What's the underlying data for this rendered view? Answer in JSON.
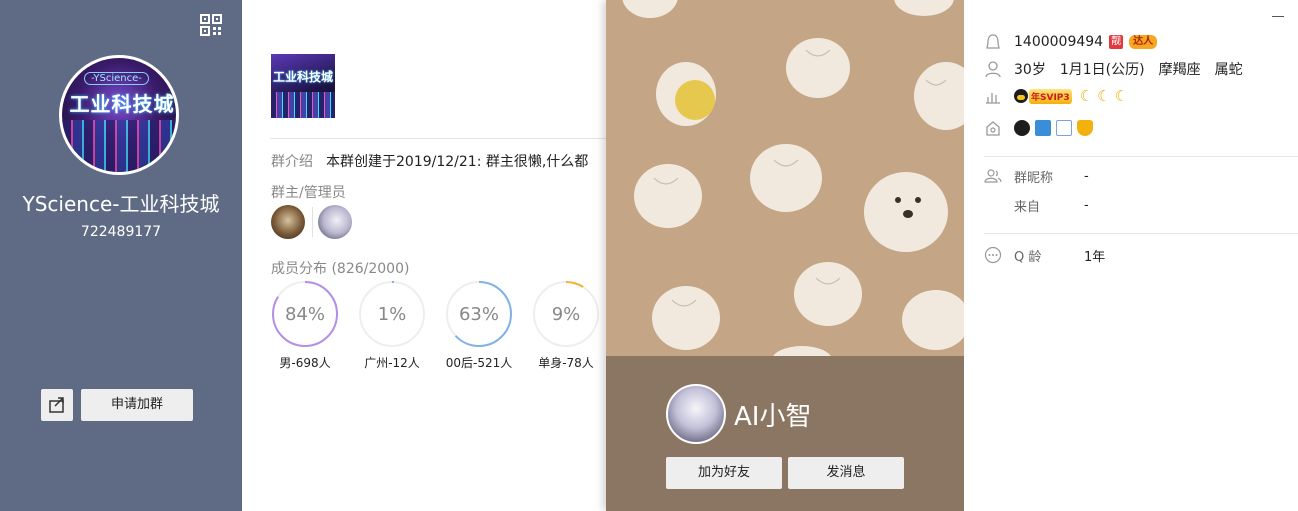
{
  "group": {
    "name": "YScience-工业科技城",
    "id": "722489177",
    "avatar_text": "工业科技城",
    "avatar_tag": "-YScience-",
    "apply_label": "申请加群"
  },
  "info": {
    "intro_label": "群介绍",
    "intro_text": "本群创建于2019/12/21:  群主很懒,什么都",
    "admin_label": "群主/管理员",
    "dist_label": "成员分布",
    "dist_count": "(826/2000)",
    "stats": [
      {
        "pct": "84%",
        "value": 0.84,
        "label": "男-698人",
        "color": "#b58ee6"
      },
      {
        "pct": "1%",
        "value": 0.01,
        "label": "广州-12人",
        "color": "#7fb2e8"
      },
      {
        "pct": "63%",
        "value": 0.63,
        "label": "00后-521人",
        "color": "#7fb2e8"
      },
      {
        "pct": "9%",
        "value": 0.09,
        "label": "单身-78人",
        "color": "#f2b336"
      }
    ]
  },
  "profile": {
    "name": "AI小智",
    "add_friend_label": "加为好友",
    "message_label": "发消息",
    "qq": "1400009494",
    "badge_liang": "靓",
    "badge_daren": "达人",
    "age": "30岁",
    "birthday": "1月1日(公历)",
    "zodiac": "摩羯座",
    "chinese_zodiac": "属蛇",
    "vip_label": "年SVIP3",
    "nickname_label": "群昵称",
    "nickname_value": "-",
    "from_label": "来自",
    "from_value": "-",
    "qage_label": "Q 龄",
    "qage_value": "1年"
  },
  "colors": {
    "left_panel": "#5f6b85",
    "card_bg": "#c4a686",
    "card_bottom": "#8a7662"
  }
}
